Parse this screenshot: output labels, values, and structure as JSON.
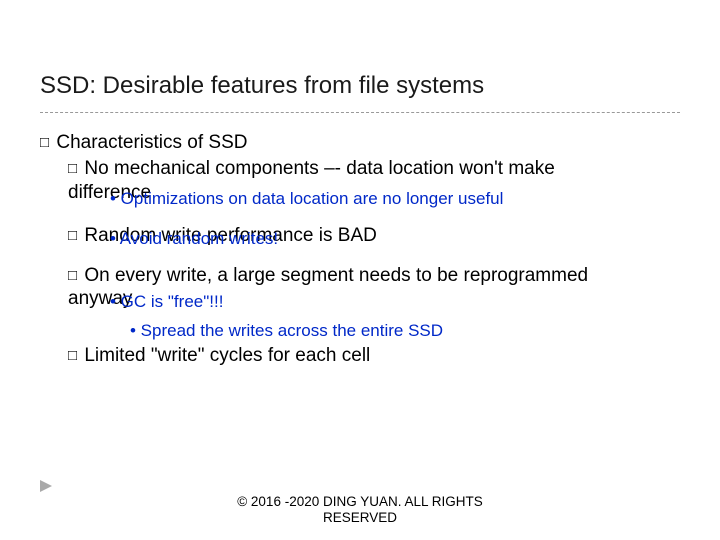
{
  "title": "SSD: Desirable features from file systems",
  "l1": {
    "sq": "□",
    "text": "Characteristics of SSD"
  },
  "b1": {
    "sq": "□",
    "text_a": "No mechanical components –- data location won't make",
    "text_b": "difference",
    "note": "• Optimizations on data location are no longer useful"
  },
  "b2": {
    "sq": "□",
    "text": "Random write performance is BAD",
    "note": "• Avoid random writes!"
  },
  "b3": {
    "sq": "□",
    "text_a": "On every write, a large segment needs to be reprogrammed",
    "text_b": "anyway",
    "note": "• GC is \"free\"!!!"
  },
  "b4": {
    "sq": "□",
    "text": "Limited \"write\" cycles for each cell",
    "note": "• Spread the writes across the entire SSD"
  },
  "footer_l1": "© 2016 -2020 DING YUAN. ALL RIGHTS",
  "footer_l2": "RESERVED"
}
